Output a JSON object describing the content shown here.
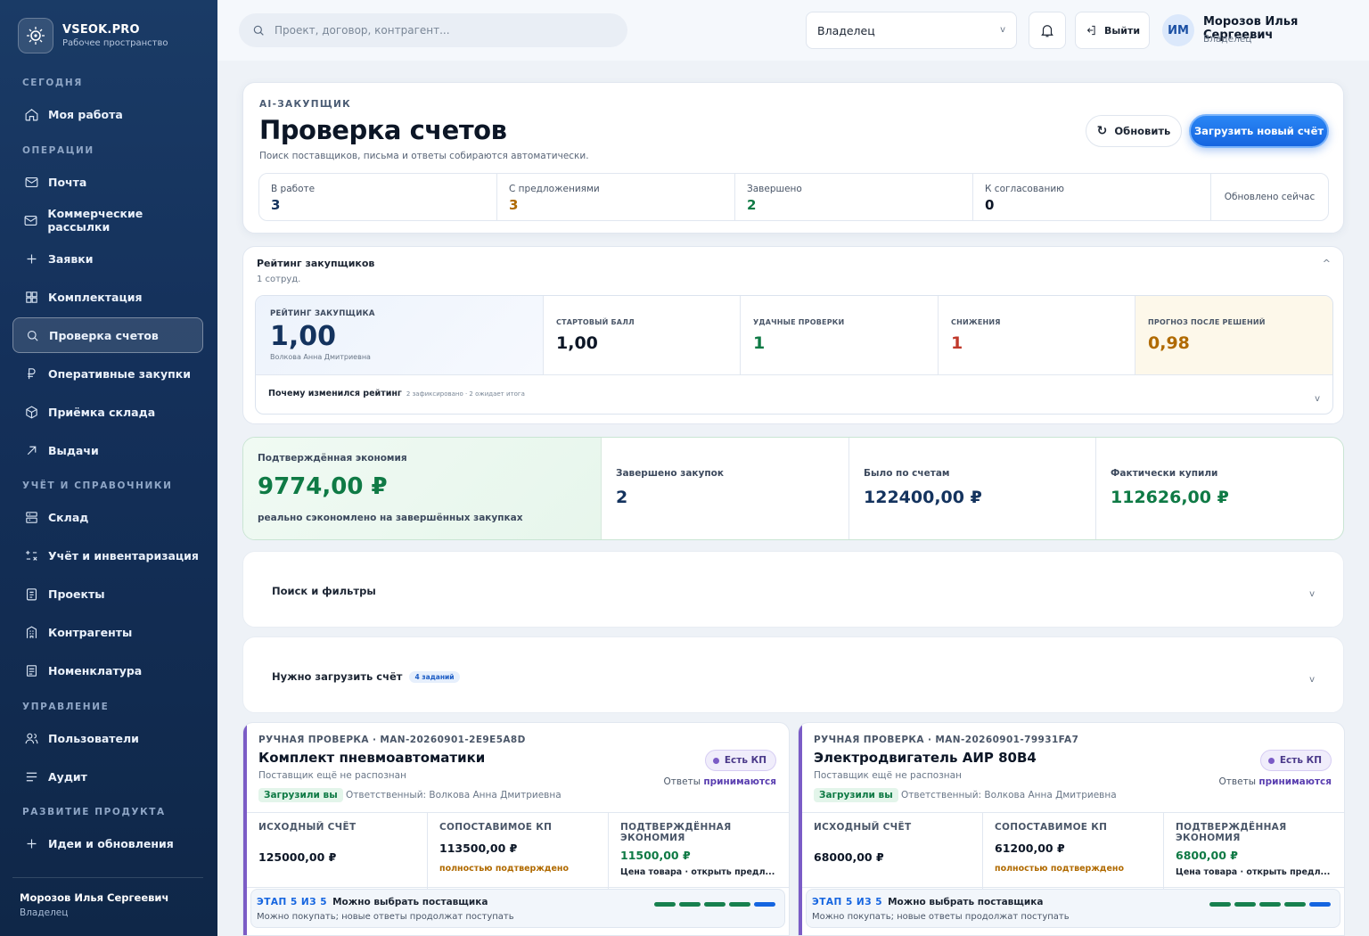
{
  "brand": {
    "name": "VSEOK.PRO",
    "subtitle": "Рабочее пространство"
  },
  "sidebar": {
    "sections": [
      {
        "title": "СЕГОДНЯ"
      },
      {
        "title": "ОПЕРАЦИИ"
      },
      {
        "title": "УЧЁТ И СПРАВОЧНИКИ"
      },
      {
        "title": "УПРАВЛЕНИЕ"
      },
      {
        "title": "РАЗВИТИЕ ПРОДУКТА"
      }
    ],
    "items": [
      {
        "label": "Моя работа",
        "icon": "home-icon"
      },
      {
        "label": "Почта",
        "icon": "mail-icon"
      },
      {
        "label": "Коммерческие рассылки",
        "icon": "mail-icon"
      },
      {
        "label": "Заявки",
        "icon": "plus-icon"
      },
      {
        "label": "Комплектация",
        "icon": "grid-icon"
      },
      {
        "label": "Проверка счетов",
        "icon": "search-icon",
        "active": true
      },
      {
        "label": "Оперативные закупки",
        "icon": "ruble-icon"
      },
      {
        "label": "Приёмка склада",
        "icon": "box-icon"
      },
      {
        "label": "Выдачи",
        "icon": "arrow-up-right-icon"
      },
      {
        "label": "Склад",
        "icon": "warehouse-icon"
      },
      {
        "label": "Учёт и инвентаризация",
        "icon": "calc-icon"
      },
      {
        "label": "Проекты",
        "icon": "clipboard-icon"
      },
      {
        "label": "Контрагенты",
        "icon": "building-icon"
      },
      {
        "label": "Номенклатура",
        "icon": "list-icon"
      },
      {
        "label": "Пользователи",
        "icon": "users-icon"
      },
      {
        "label": "Аудит",
        "icon": "menu-icon"
      },
      {
        "label": "Идеи и обновления",
        "icon": "plus-icon"
      }
    ],
    "user": {
      "name": "Морозов Илья Сергеевич",
      "role": "Владелец"
    }
  },
  "topbar": {
    "search_placeholder": "Проект, договор, контрагент...",
    "role_select": "Владелец",
    "logout_label": "Выйти",
    "avatar_initials": "ИМ",
    "user_name": "Морозов Илья Сергеевич",
    "user_role": "Владелец"
  },
  "hero": {
    "eyebrow": "AI-ЗАКУПЩИК",
    "title": "Проверка счетов",
    "subtitle": "Поиск поставщиков, письма и ответы собираются автоматически.",
    "refresh_label": "Обновить",
    "upload_label": "Загрузить новый счёт",
    "stats": [
      {
        "label": "В работе",
        "value": "3",
        "color": "#14335e"
      },
      {
        "label": "С предложениями",
        "value": "3",
        "color": "#b06a00"
      },
      {
        "label": "Завершено",
        "value": "2",
        "color": "#0f7a45"
      },
      {
        "label": "К согласованию",
        "value": "0",
        "color": "#0c1626"
      }
    ],
    "updated": "Обновлено сейчас"
  },
  "rating": {
    "title": "Рейтинг закупщиков",
    "subtitle": "1 сотруд.",
    "main_label": "РЕЙТИНГ ЗАКУПЩИКА",
    "main_value": "1,00",
    "main_name": "Волкова Анна Дмитриевна",
    "cells": [
      {
        "label": "СТАРТОВЫЙ БАЛЛ",
        "value": "1,00",
        "color": "#0c1626"
      },
      {
        "label": "УДАЧНЫЕ ПРОВЕРКИ",
        "value": "1",
        "color": "#0f7a45"
      },
      {
        "label": "СНИЖЕНИЯ",
        "value": "1",
        "color": "#c0392b"
      },
      {
        "label": "ПРОГНОЗ ПОСЛЕ РЕШЕНИЙ",
        "value": "0,98",
        "color": "#b06a00"
      }
    ],
    "why_label": "Почему изменился рейтинг",
    "why_meta": "2 зафиксировано · 2 ожидает итога"
  },
  "savings": {
    "main_label": "Подтверждённая экономия",
    "main_value": "9774,00 ₽",
    "main_note": "реально сэкономлено на завершённых закупках",
    "cells": [
      {
        "label": "Завершено закупок",
        "value": "2",
        "color": "#14335e"
      },
      {
        "label": "Было по счетам",
        "value": "122400,00 ₽",
        "color": "#14335e"
      },
      {
        "label": "Фактически купили",
        "value": "112626,00 ₽",
        "color": "#0f7a45"
      }
    ]
  },
  "filters": {
    "title": "Поиск и фильтры"
  },
  "upload_needed": {
    "title": "Нужно загрузить счёт",
    "count": "4 заданий"
  },
  "procurements": [
    {
      "id": "РУЧНАЯ ПРОВЕРКА · MAN-20260901-2E9E5A8D",
      "title": "Комплект пневмоавтоматики",
      "supplier": "Поставщик ещё не распознан",
      "status": "Загрузили вы",
      "responsible": "Ответственный: Волкова Анна Дмитриевна",
      "badge": "Есть КП",
      "answers_prefix": "Ответы",
      "answers_state": "принимаются",
      "col1_label": "ИСХОДНЫЙ СЧЁТ",
      "col1_value": "125000,00 ₽",
      "col2_label": "СОПОСТАВИМОЕ КП",
      "col2_value": "113500,00 ₽",
      "col2_note": "полностью подтверждено",
      "col3_label": "ПОДТВЕРЖДЁННАЯ ЭКОНОМИЯ",
      "col3_value": "11500,00 ₽",
      "col3_note": "Цена товара · открыть предл...",
      "stage_step": "ЭТАП 5 ИЗ 5",
      "stage_title": "Можно выбрать поставщика",
      "stage_note": "Можно покупать; новые ответы продолжат поступать"
    },
    {
      "id": "РУЧНАЯ ПРОВЕРКА · MAN-20260901-79931FA7",
      "title": "Электродвигатель АИР 80В4",
      "supplier": "Поставщик ещё не распознан",
      "status": "Загрузили вы",
      "responsible": "Ответственный: Волкова Анна Дмитриевна",
      "badge": "Есть КП",
      "answers_prefix": "Ответы",
      "answers_state": "принимаются",
      "col1_label": "ИСХОДНЫЙ СЧЁТ",
      "col1_value": "68000,00 ₽",
      "col2_label": "СОПОСТАВИМОЕ КП",
      "col2_value": "61200,00 ₽",
      "col2_note": "полностью подтверждено",
      "col3_label": "ПОДТВЕРЖДЁННАЯ ЭКОНОМИЯ",
      "col3_value": "6800,00 ₽",
      "col3_note": "Цена товара · открыть предл...",
      "stage_step": "ЭТАП 5 ИЗ 5",
      "stage_title": "Можно выбрать поставщика",
      "stage_note": "Можно покупать; новые ответы продолжат поступать"
    }
  ]
}
